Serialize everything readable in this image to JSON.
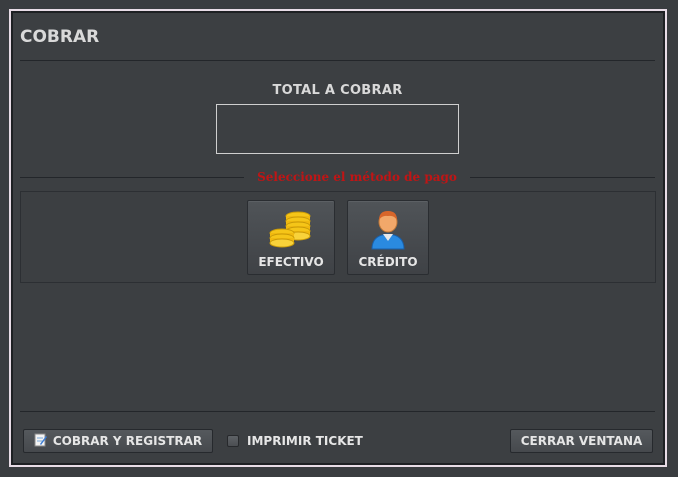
{
  "window": {
    "title": "COBRAR"
  },
  "total": {
    "label": "TOTAL A COBRAR",
    "value": ""
  },
  "payment": {
    "prompt": "Seleccione el método de pago",
    "methods": [
      {
        "label": "EFECTIVO",
        "icon": "coins-icon"
      },
      {
        "label": "CRÉDITO",
        "icon": "person-icon"
      }
    ]
  },
  "footer": {
    "cobrar_label": "COBRAR Y REGISTRAR",
    "print_label": "IMPRIMIR TICKET",
    "print_checked": false,
    "close_label": "CERRAR VENTANA"
  },
  "colors": {
    "background": "#3c3f42",
    "prompt": "#c01515",
    "coin": "#f5c518",
    "person_shirt": "#2a8ae0"
  }
}
